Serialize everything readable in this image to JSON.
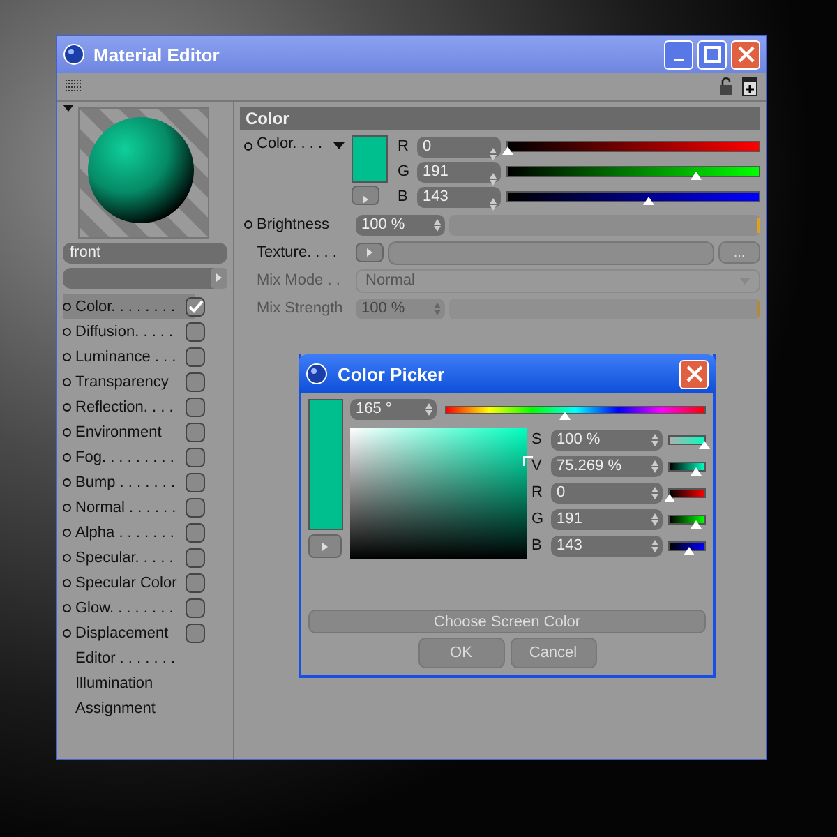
{
  "window": {
    "title": "Material Editor"
  },
  "preview": {
    "name": "front"
  },
  "channels": [
    {
      "label": "Color. . . . . . . .",
      "kind": "toggle",
      "checked": true,
      "selected": true
    },
    {
      "label": "Diffusion. . . . .",
      "kind": "toggle",
      "checked": false,
      "selected": false
    },
    {
      "label": "Luminance . . .",
      "kind": "toggle",
      "checked": false,
      "selected": false
    },
    {
      "label": "Transparency",
      "kind": "toggle",
      "checked": false,
      "selected": false
    },
    {
      "label": "Reflection. . . .",
      "kind": "toggle",
      "checked": false,
      "selected": false
    },
    {
      "label": "Environment",
      "kind": "toggle",
      "checked": false,
      "selected": false
    },
    {
      "label": "Fog. . . . . . . . .",
      "kind": "toggle",
      "checked": false,
      "selected": false
    },
    {
      "label": "Bump . . . . . . .",
      "kind": "toggle",
      "checked": false,
      "selected": false
    },
    {
      "label": "Normal . . . . . .",
      "kind": "toggle",
      "checked": false,
      "selected": false
    },
    {
      "label": "Alpha . . . . . . .",
      "kind": "toggle",
      "checked": false,
      "selected": false
    },
    {
      "label": "Specular. . . . .",
      "kind": "toggle",
      "checked": false,
      "selected": false
    },
    {
      "label": "Specular Color",
      "kind": "toggle",
      "checked": false,
      "selected": false
    },
    {
      "label": "Glow. . . . . . . .",
      "kind": "toggle",
      "checked": false,
      "selected": false
    },
    {
      "label": "Displacement",
      "kind": "toggle",
      "checked": false,
      "selected": false
    },
    {
      "label": "Editor . . . . . . .",
      "kind": "plain",
      "selected": false
    },
    {
      "label": "Illumination",
      "kind": "plain",
      "selected": false
    },
    {
      "label": "Assignment",
      "kind": "plain",
      "selected": false
    }
  ],
  "section": {
    "title": "Color"
  },
  "color": {
    "label": "Color. . . .",
    "sliders": [
      {
        "name": "R",
        "value": "0",
        "level": 0,
        "kind": "r"
      },
      {
        "name": "G",
        "value": "191",
        "level": 0.749,
        "kind": "g"
      },
      {
        "name": "B",
        "value": "143",
        "level": 0.561,
        "kind": "b"
      }
    ]
  },
  "brightness": {
    "label": "Brightness",
    "value": "100 %",
    "level": 1
  },
  "texture": {
    "label": "Texture. . . .",
    "browse": "..."
  },
  "mix_mode": {
    "label": "Mix Mode . .",
    "value": "Normal",
    "disabled": true
  },
  "mix_strength": {
    "label": "Mix Strength",
    "value": "100 %",
    "level": 1,
    "disabled": true
  },
  "picker": {
    "title": "Color Picker",
    "hue": {
      "value": "165 °",
      "level": 0.458
    },
    "fields": [
      {
        "name": "S",
        "value": "100 %",
        "level": 1,
        "kind": "s"
      },
      {
        "name": "V",
        "value": "75.269 %",
        "level": 0.753,
        "kind": "v"
      },
      {
        "name": "R",
        "value": "0",
        "level": 0,
        "kind": "r"
      },
      {
        "name": "G",
        "value": "191",
        "level": 0.749,
        "kind": "g"
      },
      {
        "name": "B",
        "value": "143",
        "level": 0.561,
        "kind": "b"
      }
    ],
    "screen_button": "Choose Screen Color",
    "buttons": [
      "OK",
      "Cancel"
    ]
  }
}
